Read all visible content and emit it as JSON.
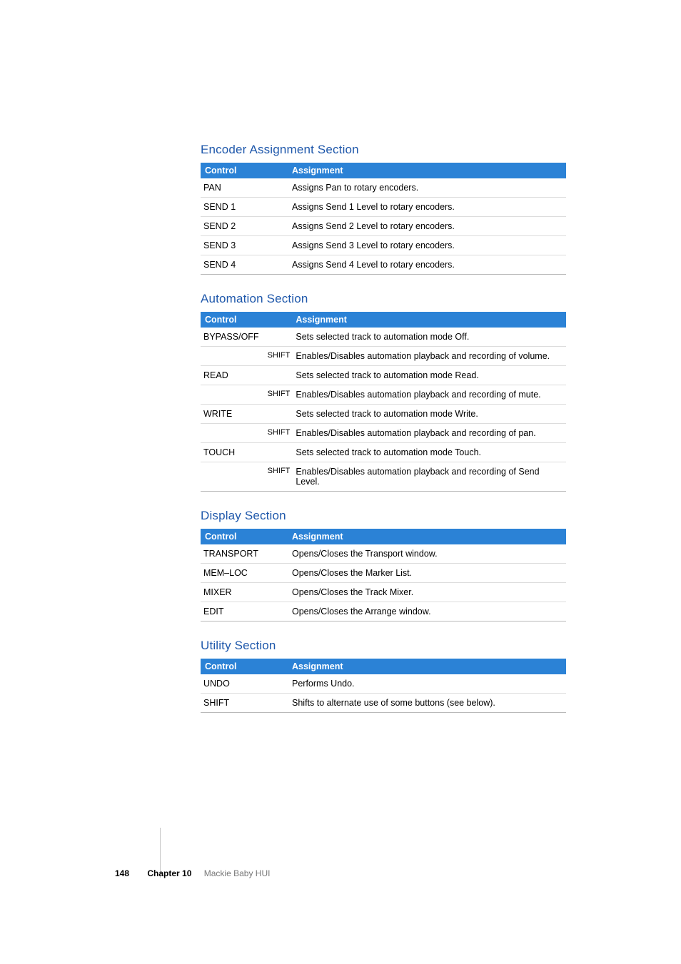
{
  "sections": {
    "encoder": {
      "title": "Encoder Assignment Section",
      "headers": {
        "control": "Control",
        "assignment": "Assignment"
      },
      "rows": [
        {
          "control": "PAN",
          "assignment": "Assigns Pan to rotary encoders."
        },
        {
          "control": "SEND 1",
          "assignment": "Assigns Send 1 Level to rotary encoders."
        },
        {
          "control": "SEND 2",
          "assignment": "Assigns Send 2 Level to rotary encoders."
        },
        {
          "control": "SEND 3",
          "assignment": "Assigns Send 3 Level to rotary encoders."
        },
        {
          "control": "SEND 4",
          "assignment": "Assigns Send 4 Level to rotary encoders."
        }
      ]
    },
    "automation": {
      "title": "Automation Section",
      "headers": {
        "control": "Control",
        "assignment": "Assignment"
      },
      "rows": [
        {
          "control": "BYPASS/OFF",
          "mod": "",
          "assignment": "Sets selected track to automation mode Off."
        },
        {
          "control": "",
          "mod": "SHIFT",
          "assignment": "Enables/Disables automation playback and recording of volume."
        },
        {
          "control": "READ",
          "mod": "",
          "assignment": "Sets selected track to automation mode Read."
        },
        {
          "control": "",
          "mod": "SHIFT",
          "assignment": "Enables/Disables automation playback and recording of mute."
        },
        {
          "control": "WRITE",
          "mod": "",
          "assignment": "Sets selected track to automation mode Write."
        },
        {
          "control": "",
          "mod": "SHIFT",
          "assignment": "Enables/Disables automation playback and recording of pan."
        },
        {
          "control": "TOUCH",
          "mod": "",
          "assignment": "Sets selected track to automation mode Touch."
        },
        {
          "control": "",
          "mod": "SHIFT",
          "assignment": "Enables/Disables automation playback and recording of Send Level."
        }
      ]
    },
    "display": {
      "title": "Display Section",
      "headers": {
        "control": "Control",
        "assignment": "Assignment"
      },
      "rows": [
        {
          "control": "TRANSPORT",
          "assignment": "Opens/Closes the Transport window."
        },
        {
          "control": "MEM–LOC",
          "assignment": "Opens/Closes the Marker List."
        },
        {
          "control": "MIXER",
          "assignment": "Opens/Closes the Track Mixer."
        },
        {
          "control": "EDIT",
          "assignment": "Opens/Closes the Arrange window."
        }
      ]
    },
    "utility": {
      "title": "Utility Section",
      "headers": {
        "control": "Control",
        "assignment": "Assignment"
      },
      "rows": [
        {
          "control": "UNDO",
          "assignment": "Performs Undo."
        },
        {
          "control": "SHIFT",
          "assignment": "Shifts to alternate use of some buttons (see below)."
        }
      ]
    }
  },
  "footer": {
    "page_number": "148",
    "chapter_label": "Chapter 10",
    "chapter_title": "Mackie Baby HUI"
  }
}
